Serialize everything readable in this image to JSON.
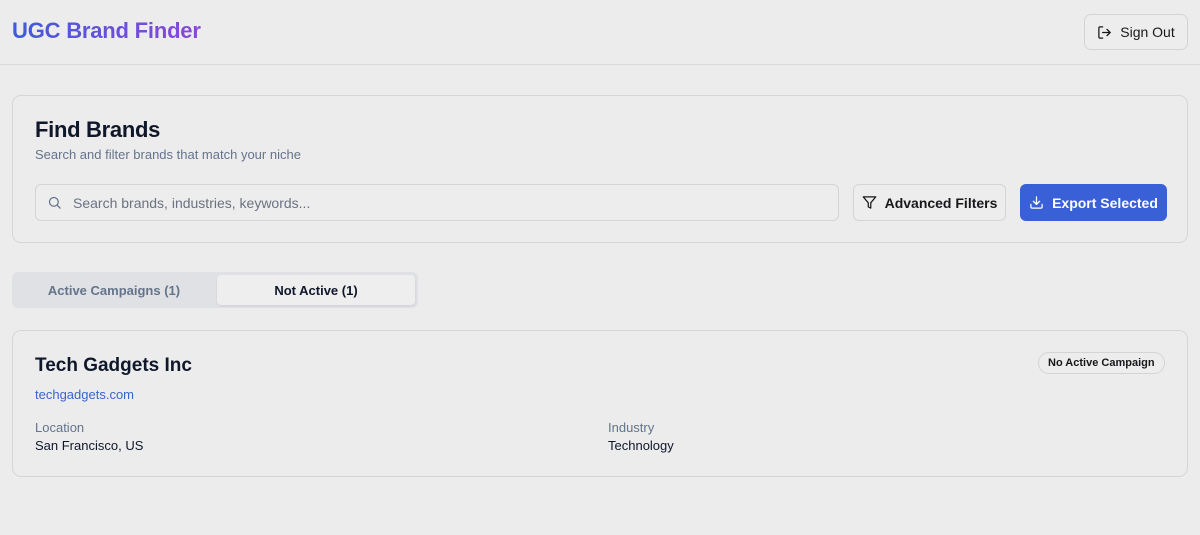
{
  "header": {
    "app_title": "UGC Brand Finder",
    "signout_label": "Sign Out"
  },
  "search_section": {
    "title": "Find Brands",
    "subtitle": "Search and filter brands that match your niche",
    "search_placeholder": "Search brands, industries, keywords...",
    "search_value": "",
    "advanced_filters_label": "Advanced Filters",
    "export_label": "Export Selected"
  },
  "tabs": [
    {
      "label": "Active Campaigns (1)",
      "active": false
    },
    {
      "label": "Not Active (1)",
      "active": true
    }
  ],
  "brands": [
    {
      "name": "Tech Gadgets Inc",
      "website": "techgadgets.com",
      "status": "No Active Campaign",
      "location_label": "Location",
      "location": "San Francisco, US",
      "industry_label": "Industry",
      "industry": "Technology"
    }
  ],
  "colors": {
    "accent": "#3960d6",
    "title_gradient_start": "#3f5bd9",
    "title_gradient_end": "#8b48d6",
    "link": "#3b64d0",
    "background": "#ececec"
  },
  "icons": {
    "signout": "log-out-icon",
    "search": "search-icon",
    "filter": "filter-icon",
    "export": "download-icon"
  }
}
